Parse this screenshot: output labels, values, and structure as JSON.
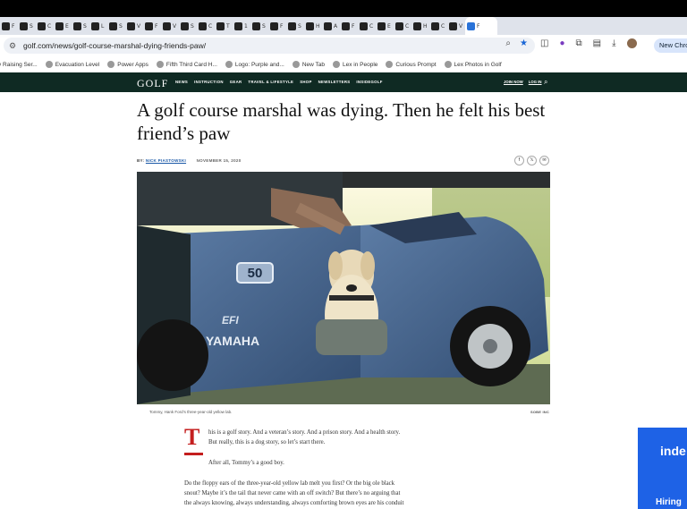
{
  "browser": {
    "tab_letters": [
      "F",
      "S",
      "C",
      "E",
      "S",
      "L",
      "S",
      "V",
      "F",
      "V",
      "S",
      "C",
      "T",
      "1",
      "S",
      "F",
      "S",
      "H",
      "A",
      "F",
      "C",
      "E",
      "C",
      "H",
      "C",
      "V",
      "F"
    ],
    "url": "golf.com/news/golf-course-marshal-dying-friends-paw/",
    "new_chrome_label": "New Chro",
    "bookmarks": [
      "y Raising Ser...",
      "Evacuation Level",
      "Power Apps",
      "Fifth Third Card H...",
      "Logo: Purple and...",
      "New Tab",
      "Lex in People",
      "Curious Prompt",
      "Lex Photos in Golf"
    ]
  },
  "site": {
    "logo": "GOLF",
    "nav": [
      "NEWS",
      "INSTRUCTION",
      "GEAR",
      "TRAVEL & LIFESTYLE",
      "SHOP",
      "NEWSLETTERS",
      "INSIDEGOLF"
    ],
    "join": "JOIN NOW",
    "login": "LOG IN"
  },
  "article": {
    "headline": "A golf course marshal was dying. Then he felt his best friend’s paw",
    "by_prefix": "BY:",
    "author": "NICK PIASTOWSKI",
    "date": "NOVEMBER 15, 2020",
    "image_caption": "Tommy, Hank Ford’s three-year-old yellow lab.",
    "image_credit": "SOBE INC",
    "cart_number": "50",
    "cart_brand": "YAMAHA",
    "cart_badge": "EFI",
    "dropcap": "T",
    "para1_line1": "his is a golf story. And a veteran’s story. And a prison story. And a health story.",
    "para1_line2": "But really, this is a dog story, so let’s start there.",
    "para2": "After all, Tommy’s a good boy.",
    "para3_line1": "Do the floppy ears of the three-year-old yellow lab melt you first? Or the big ole black",
    "para3_line2": "snout? Maybe it’s the tail that never came with an off switch? But there’s no arguing that",
    "para3_line3": "the always knowing, always understanding, always comforting brown eyes are his conduit"
  },
  "ad": {
    "line1": "inde",
    "line2": "Hiring"
  },
  "colors": {
    "nav_bg": "#0f2a23",
    "accent_red": "#c41e1e",
    "link_blue": "#1c5aa8",
    "ad_blue": "#1e62e6"
  }
}
